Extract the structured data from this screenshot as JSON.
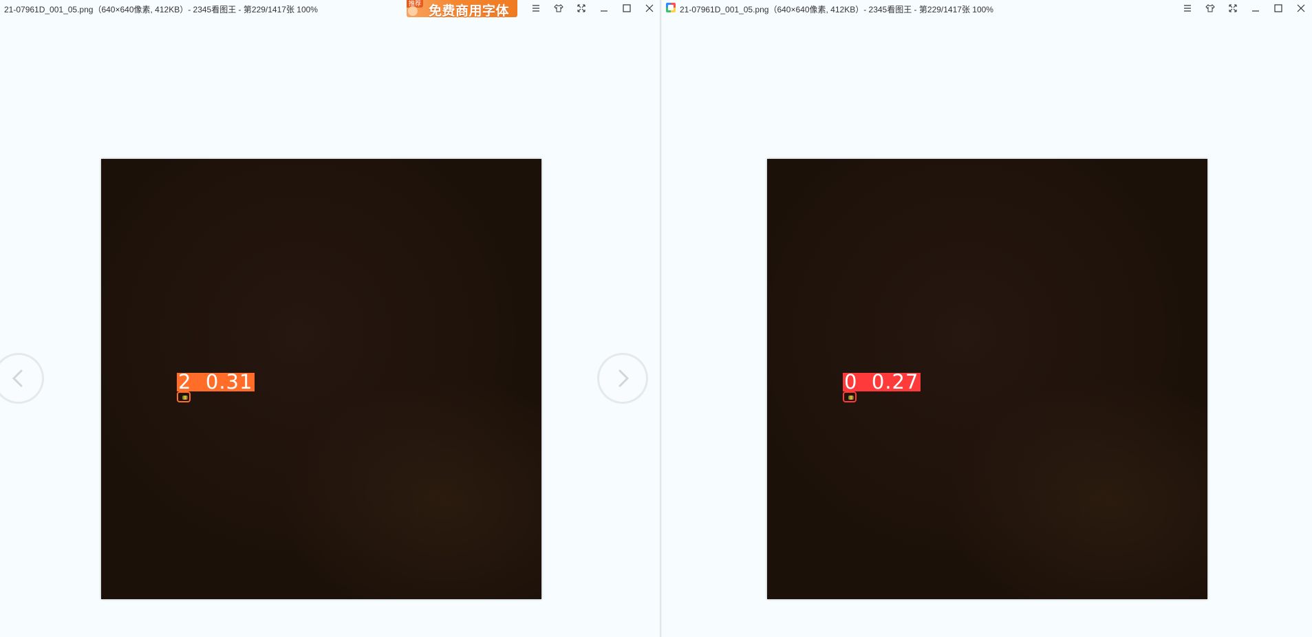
{
  "left_pane": {
    "title": "21-07961D_001_05.png（640×640像素, 412KB）- 2345看图王 - 第229/1417张 100%",
    "ad": {
      "tag": "推荐",
      "text": "免费商用字体"
    },
    "window_buttons": [
      "menu-icon",
      "skin-icon",
      "fullscreen-icon",
      "minimize-icon",
      "maximize-icon",
      "close-icon"
    ],
    "detection": {
      "label": "2  0.31",
      "color": "#ff6d29"
    }
  },
  "right_pane": {
    "title": "21-07961D_001_05.png（640×640像素, 412KB）- 2345看图王 - 第229/1417张 100%",
    "window_buttons": [
      "menu-icon",
      "skin-icon",
      "fullscreen-icon",
      "minimize-icon",
      "maximize-icon",
      "close-icon"
    ],
    "detection": {
      "label": "0  0.27",
      "color": "#ff3a3a"
    }
  },
  "navigation": {
    "prev_icon": "chevron-left-icon",
    "next_icon": "chevron-right-icon"
  }
}
